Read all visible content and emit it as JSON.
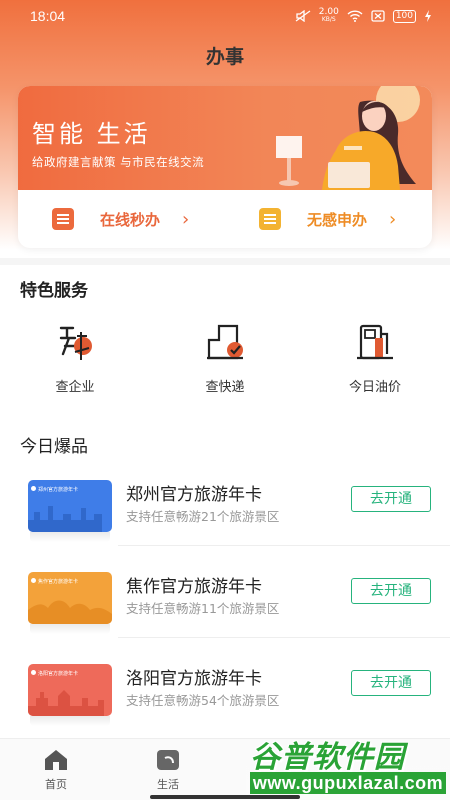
{
  "status_bar": {
    "time": "18:04",
    "speed_value": "2.00",
    "speed_unit": "KB/S",
    "battery": "100"
  },
  "page": {
    "title": "办事"
  },
  "banner": {
    "title": "智能 生活",
    "subtitle": "给政府建言献策 与市民在线交流"
  },
  "quick_actions": [
    {
      "label": "在线秒办",
      "icon": "document-edit-icon"
    },
    {
      "label": "无感申办",
      "icon": "clipboard-list-icon"
    }
  ],
  "featured": {
    "title": "特色服务",
    "items": [
      {
        "label": "查企业",
        "icon": "enterprise-icon"
      },
      {
        "label": "查快递",
        "icon": "parcel-icon"
      },
      {
        "label": "今日油价",
        "icon": "fuel-pump-icon"
      }
    ]
  },
  "hot": {
    "title": "今日爆品",
    "products": [
      {
        "name": "郑州官方旅游年卡",
        "desc": "支持任意畅游21个旅游景区",
        "button": "去开通",
        "card_text": "郑州官方旅游年卡",
        "color": "#3f7de8"
      },
      {
        "name": "焦作官方旅游年卡",
        "desc": "支持任意畅游11个旅游景区",
        "button": "去开通",
        "card_text": "焦作官方旅游年卡",
        "color": "#f3a23a"
      },
      {
        "name": "洛阳官方旅游年卡",
        "desc": "支持任意畅游54个旅游景区",
        "button": "去开通",
        "card_text": "洛阳官方旅游年卡",
        "color": "#ee6a5a"
      }
    ]
  },
  "tabbar": [
    {
      "label": "首页",
      "icon": "home-icon"
    },
    {
      "label": "生活",
      "icon": "life-icon"
    }
  ],
  "watermark": {
    "title": "谷普软件园",
    "url": "www.gupuxlazal.com"
  },
  "colors": {
    "primary": "#f0703e",
    "accent_green": "#26b37d",
    "banner_orange": "#f28657"
  }
}
